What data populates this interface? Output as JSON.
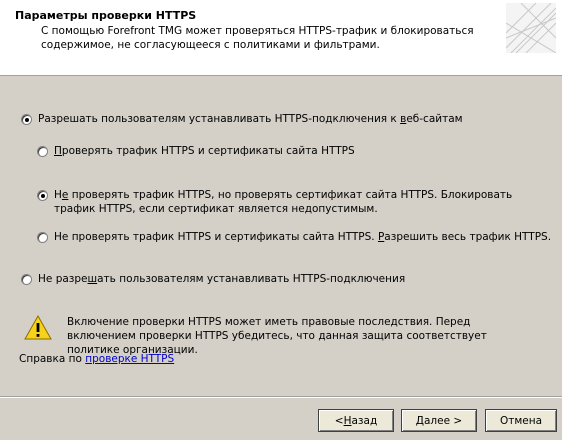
{
  "header": {
    "title": "Параметры проверки HTTPS",
    "description": "С помощью Forefront TMG может проверяться HTTPS-трафик и блокироваться содержимое, не согласующееся с политиками и фильтрами."
  },
  "options": {
    "allow": {
      "label": "Разрешать пользователям устанавливать HTTPS-подключения к веб-сайтам",
      "checked": true
    },
    "sub": [
      {
        "label": "Проверять трафик HTTPS и сертификаты сайта HTTPS",
        "checked": false
      },
      {
        "label": "Не проверять трафик HTTPS, но проверять сертификат сайта HTTPS. Блокировать трафик HTTPS, если сертификат является недопустимым.",
        "checked": true
      },
      {
        "label": "Не проверять трафик HTTPS и сертификаты сайта HTTPS. Разрешить весь трафик HTTPS.",
        "checked": false
      }
    ],
    "deny": {
      "label": "Не разрешать пользователям устанавливать HTTPS-подключения",
      "checked": false
    }
  },
  "warning": {
    "icon": "warning-icon",
    "text": "Включение проверки HTTPS может иметь правовые последствия. Перед включением проверки HTTPS убедитесь, что данная защита соответствует политике организации."
  },
  "help": {
    "prefix": "Справка по ",
    "link": "проверке HTTPS"
  },
  "buttons": {
    "back": "< Назад",
    "next": "Далее >",
    "cancel": "Отмена"
  },
  "colors": {
    "dialog_bg": "#d4d0c8",
    "header_bg": "#ffffff",
    "link": "#0000cc",
    "warning_yellow": "#f7d21a"
  }
}
